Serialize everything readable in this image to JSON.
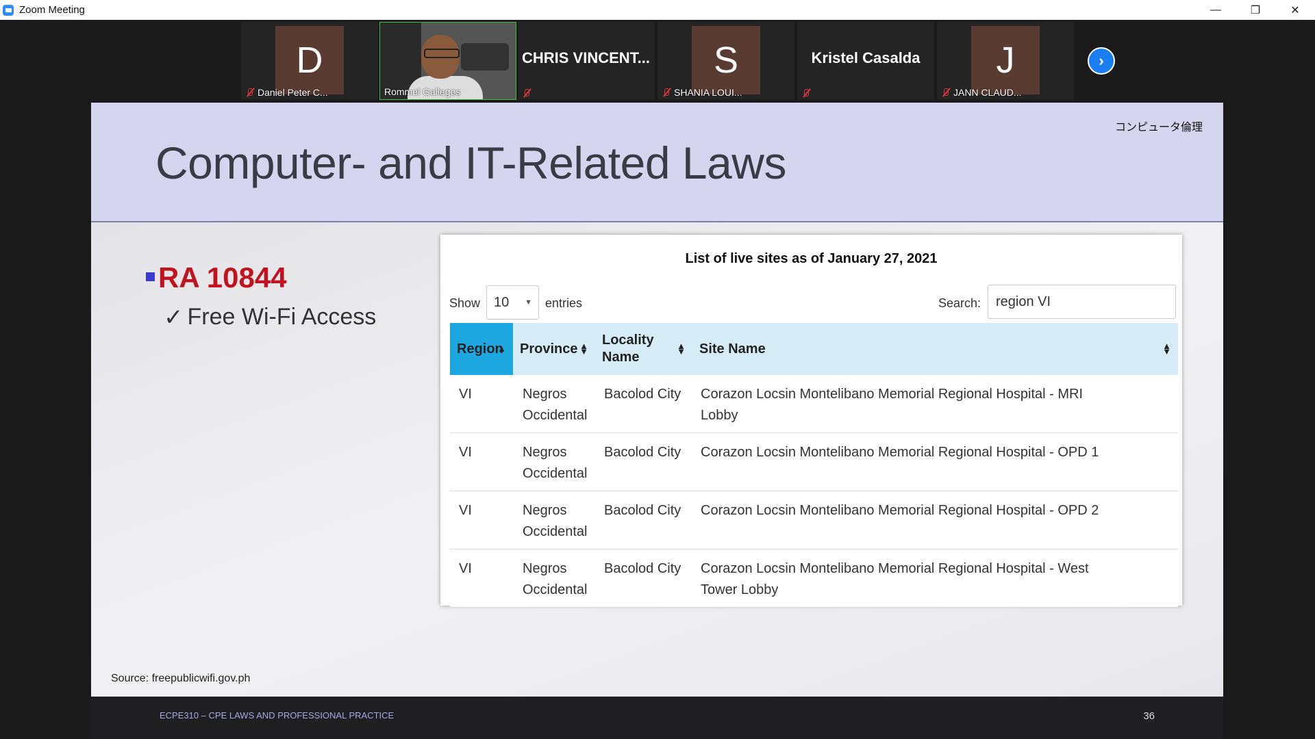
{
  "window": {
    "title": "Zoom Meeting",
    "minimize_icon": "minimize-icon",
    "maximize_icon": "restore-icon",
    "close_icon": "close-icon"
  },
  "gallery": {
    "participants": [
      {
        "initial": "D",
        "name": "Daniel Peter C...",
        "muted": true
      },
      {
        "initial": "",
        "name": "Rommel Gallegos",
        "video": true,
        "active": true
      },
      {
        "initial": "",
        "big_name": "CHRIS VINCENT...",
        "muted": true
      },
      {
        "initial": "S",
        "name": "SHANIA LOUI...",
        "muted": true
      },
      {
        "initial": "",
        "big_name": "Kristel Casalda",
        "muted": true
      },
      {
        "initial": "J",
        "name": "JANN CLAUD...",
        "muted": true
      }
    ],
    "next_icon": "chevron-right-icon"
  },
  "slide": {
    "jp_tag": "コンピュータ倫理",
    "title": "Computer- and IT-Related Laws",
    "bullet": "RA 10844",
    "sub_bullet_check": "✓",
    "sub_bullet": "Free Wi-Fi Access",
    "source": "Source: freepublicwifi.gov.ph",
    "footer_course": "ECPE310 – CPE LAWS AND PROFESSIONAL PRACTICE",
    "page_number": "36"
  },
  "table": {
    "heading": "List of live sites as of January 27, 2021",
    "show_label": "Show",
    "entries_value": "10",
    "entries_label": "entries",
    "search_label": "Search:",
    "search_value": "region VI",
    "columns": [
      "Region",
      "Province",
      "Locality\nName",
      "Site Name"
    ],
    "rows": [
      {
        "region": "VI",
        "province": "Negros\nOccidental",
        "locality": "Bacolod City",
        "site": "Corazon Locsin Montelibano Memorial Regional Hospital - MRI\nLobby"
      },
      {
        "region": "VI",
        "province": "Negros\nOccidental",
        "locality": "Bacolod City",
        "site": "Corazon Locsin Montelibano Memorial Regional Hospital - OPD 1"
      },
      {
        "region": "VI",
        "province": "Negros\nOccidental",
        "locality": "Bacolod City",
        "site": "Corazon Locsin Montelibano Memorial Regional Hospital - OPD 2"
      },
      {
        "region": "VI",
        "province": "Negros\nOccidental",
        "locality": "Bacolod City",
        "site": "Corazon Locsin Montelibano Memorial Regional Hospital - West\nTower Lobby"
      }
    ]
  }
}
